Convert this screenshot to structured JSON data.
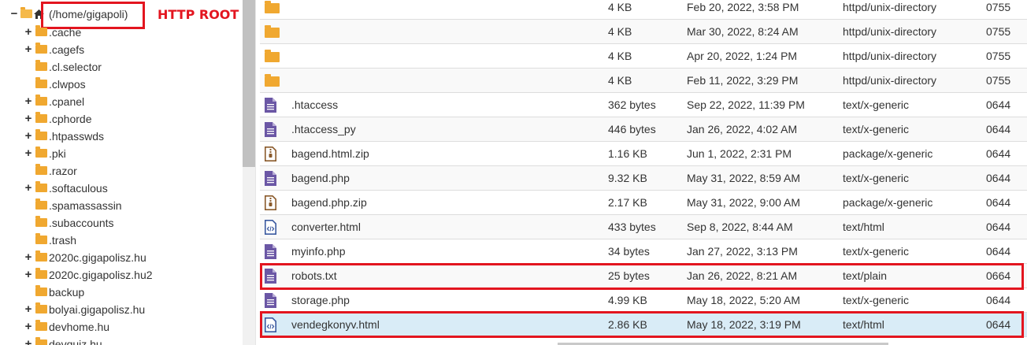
{
  "tree": {
    "root_label": "(/home/gigapoli)",
    "root_annotation": "HTTP ROOT",
    "items": [
      {
        "label": ".cache",
        "expandable": true
      },
      {
        "label": ".cagefs",
        "expandable": true
      },
      {
        "label": ".cl.selector",
        "expandable": false
      },
      {
        "label": ".clwpos",
        "expandable": false
      },
      {
        "label": ".cpanel",
        "expandable": true
      },
      {
        "label": ".cphorde",
        "expandable": true
      },
      {
        "label": ".htpasswds",
        "expandable": true
      },
      {
        "label": ".pki",
        "expandable": true
      },
      {
        "label": ".razor",
        "expandable": false
      },
      {
        "label": ".softaculous",
        "expandable": true
      },
      {
        "label": ".spamassassin",
        "expandable": false
      },
      {
        "label": ".subaccounts",
        "expandable": false
      },
      {
        "label": ".trash",
        "expandable": false
      },
      {
        "label": "2020c.gigapolisz.hu",
        "expandable": true
      },
      {
        "label": "2020c.gigapolisz.hu2",
        "expandable": true
      },
      {
        "label": "backup",
        "expandable": false
      },
      {
        "label": "bolyai.gigapolisz.hu",
        "expandable": true
      },
      {
        "label": "devhome.hu",
        "expandable": true
      },
      {
        "label": "devquiz.hu",
        "expandable": true
      }
    ]
  },
  "files": [
    {
      "icon": "folder-icon",
      "name": "",
      "size": "4 KB",
      "date": "Feb 20, 2022, 3:58 PM",
      "type": "httpd/unix-directory",
      "perm": "0755"
    },
    {
      "icon": "folder-icon",
      "name": "",
      "size": "4 KB",
      "date": "Mar 30, 2022, 8:24 AM",
      "type": "httpd/unix-directory",
      "perm": "0755"
    },
    {
      "icon": "folder-icon",
      "name": "",
      "size": "4 KB",
      "date": "Apr 20, 2022, 1:24 PM",
      "type": "httpd/unix-directory",
      "perm": "0755"
    },
    {
      "icon": "folder-icon",
      "name": "",
      "size": "4 KB",
      "date": "Feb 11, 2022, 3:29 PM",
      "type": "httpd/unix-directory",
      "perm": "0755"
    },
    {
      "icon": "text-file-icon",
      "name": ".htaccess",
      "size": "362 bytes",
      "date": "Sep 22, 2022, 11:39 PM",
      "type": "text/x-generic",
      "perm": "0644"
    },
    {
      "icon": "text-file-icon",
      "name": ".htaccess_py",
      "size": "446 bytes",
      "date": "Jan 26, 2022, 4:02 AM",
      "type": "text/x-generic",
      "perm": "0644"
    },
    {
      "icon": "zip-file-icon",
      "name": "bagend.html.zip",
      "size": "1.16 KB",
      "date": "Jun 1, 2022, 2:31 PM",
      "type": "package/x-generic",
      "perm": "0644"
    },
    {
      "icon": "text-file-icon",
      "name": "bagend.php",
      "size": "9.32 KB",
      "date": "May 31, 2022, 8:59 AM",
      "type": "text/x-generic",
      "perm": "0644"
    },
    {
      "icon": "zip-file-icon",
      "name": "bagend.php.zip",
      "size": "2.17 KB",
      "date": "May 31, 2022, 9:00 AM",
      "type": "package/x-generic",
      "perm": "0644"
    },
    {
      "icon": "code-file-icon",
      "name": "converter.html",
      "size": "433 bytes",
      "date": "Sep 8, 2022, 8:44 AM",
      "type": "text/html",
      "perm": "0644"
    },
    {
      "icon": "text-file-icon",
      "name": "myinfo.php",
      "size": "34 bytes",
      "date": "Jan 27, 2022, 3:13 PM",
      "type": "text/x-generic",
      "perm": "0644"
    },
    {
      "icon": "text-file-icon",
      "name": "robots.txt",
      "size": "25 bytes",
      "date": "Jan 26, 2022, 8:21 AM",
      "type": "text/plain",
      "perm": "0664"
    },
    {
      "icon": "text-file-icon",
      "name": "storage.php",
      "size": "4.99 KB",
      "date": "May 18, 2022, 5:20 AM",
      "type": "text/x-generic",
      "perm": "0644"
    },
    {
      "icon": "code-file-icon",
      "name": "vendegkonyv.html",
      "size": "2.86 KB",
      "date": "May 18, 2022, 3:19 PM",
      "type": "text/html",
      "perm": "0644"
    }
  ],
  "colors": {
    "highlight": "#e3151f",
    "folder": "#f0a830",
    "file_icon": "#6b57a5",
    "zip_icon": "#8a5a2b",
    "selected_row": "#d9ecf7"
  }
}
